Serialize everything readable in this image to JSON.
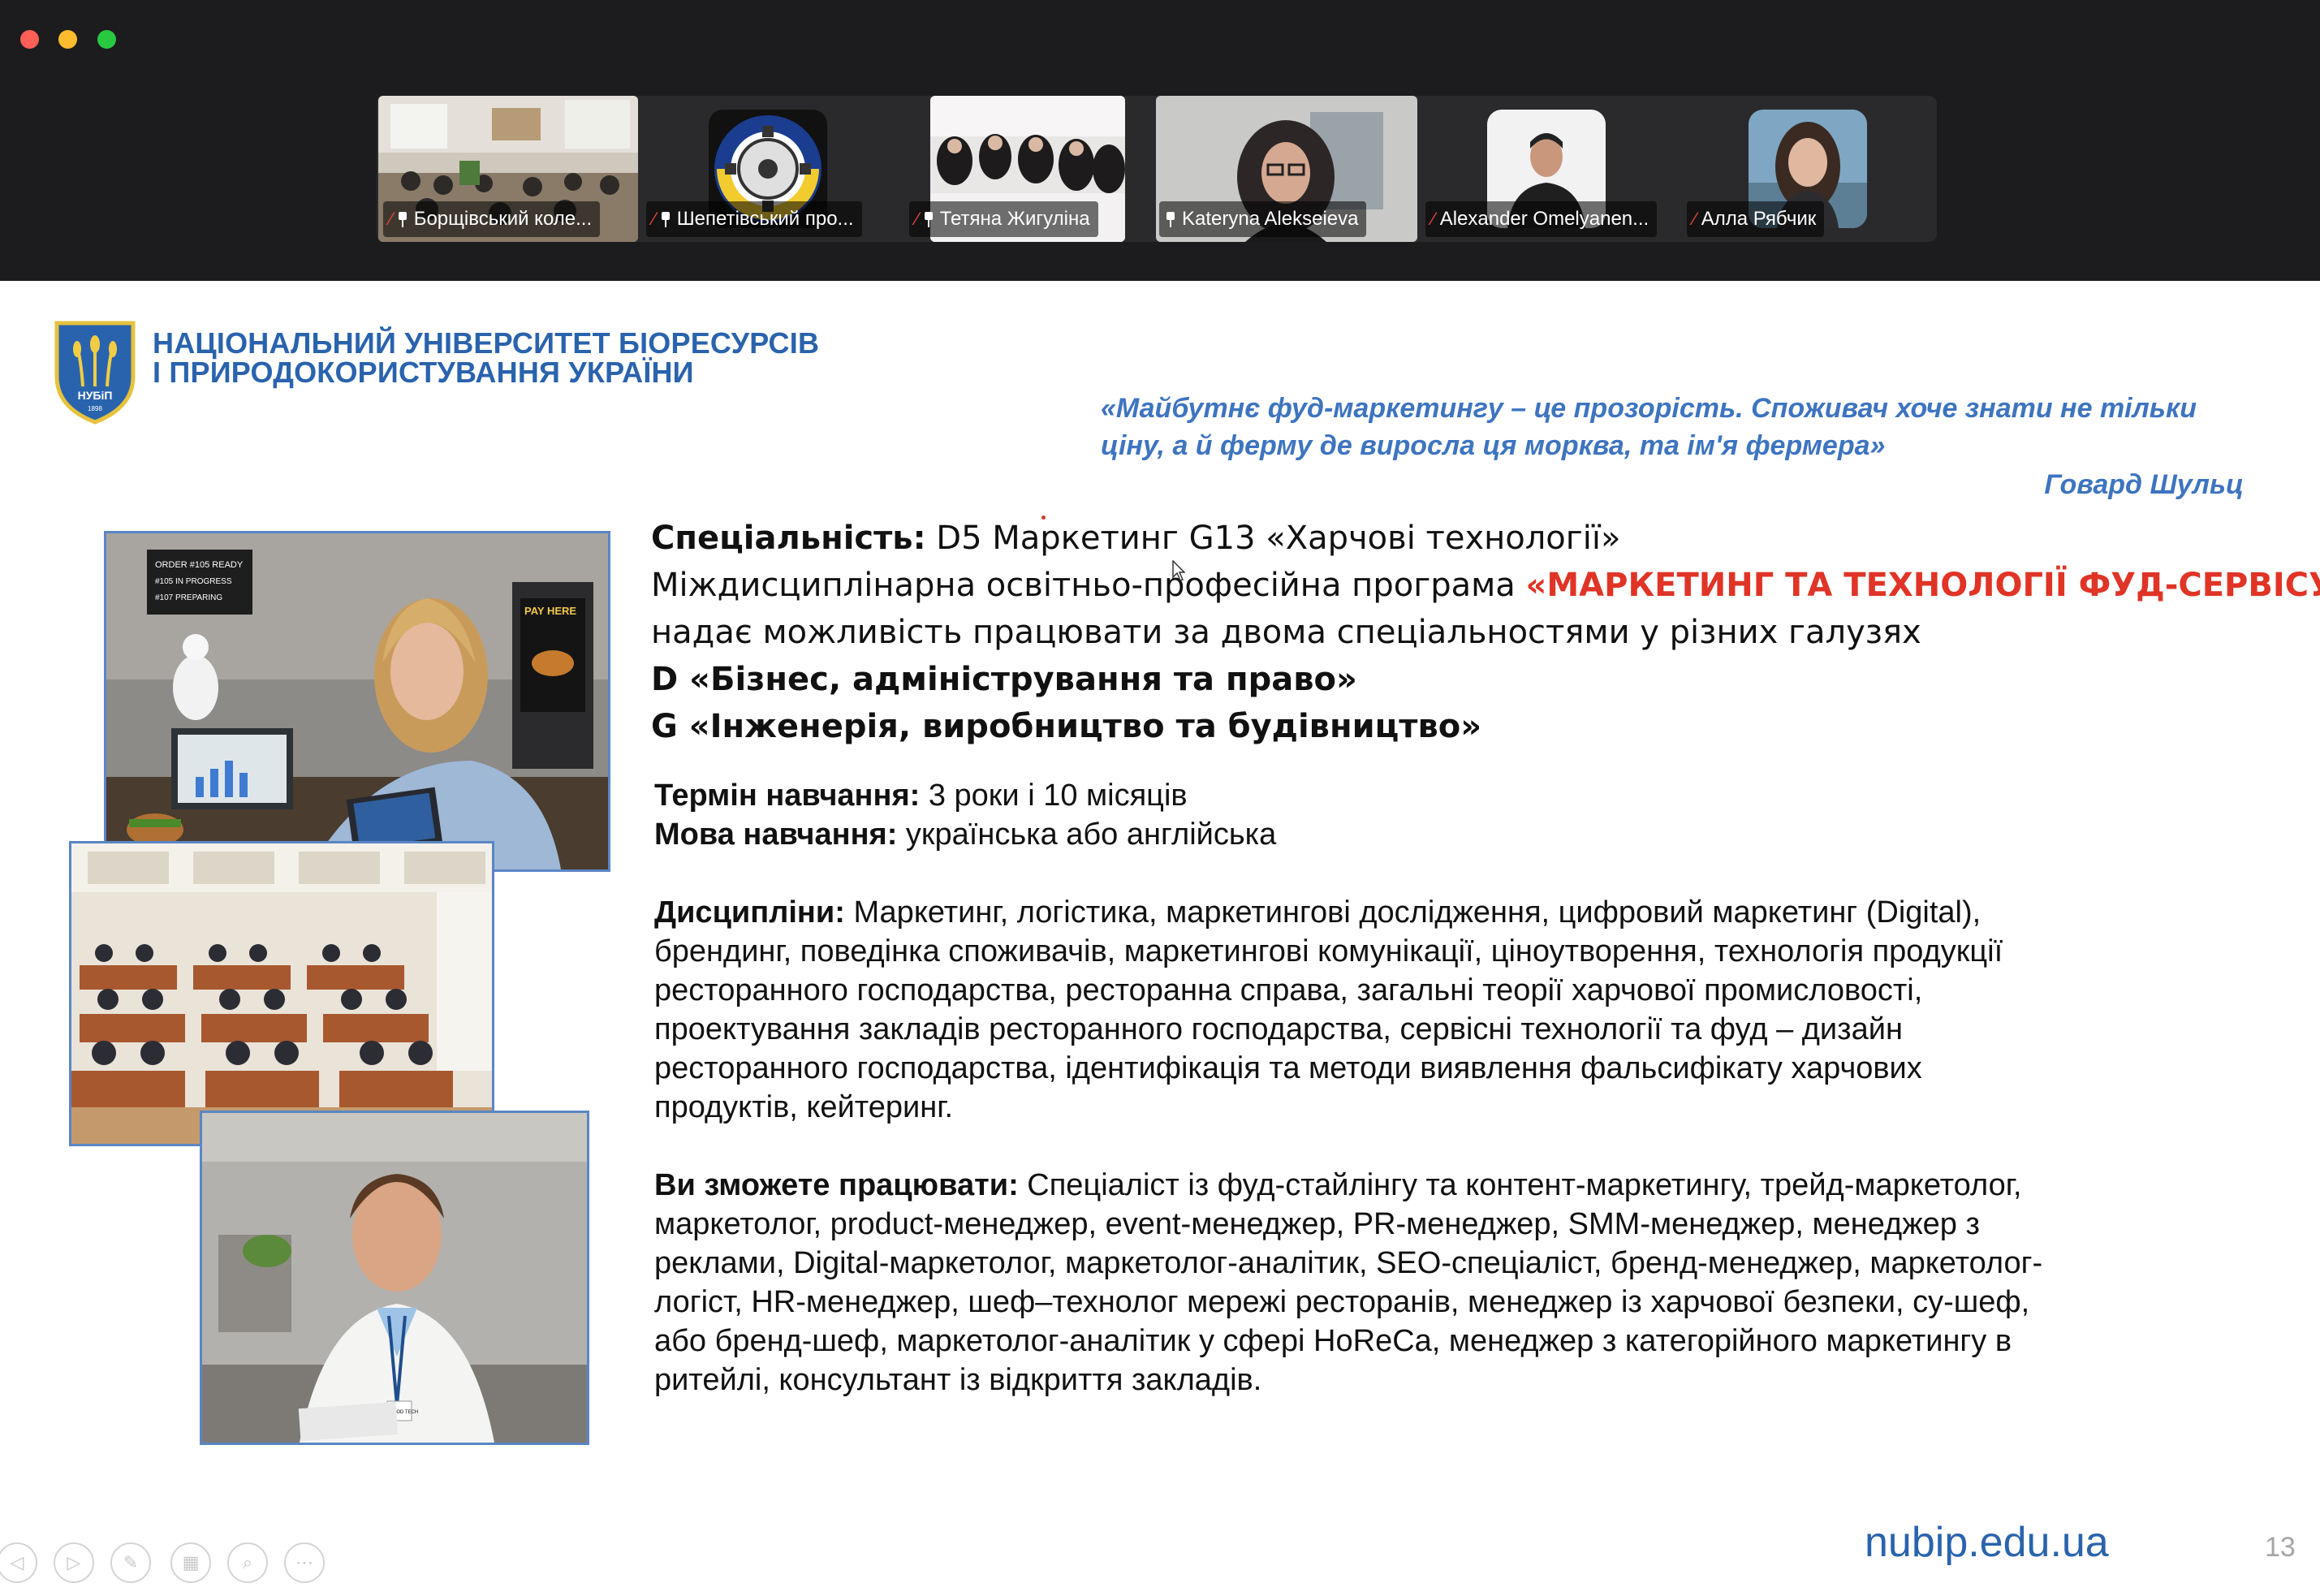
{
  "meeting": {
    "participants": [
      {
        "name": "Борщівський коле...",
        "muted": true,
        "pinned": true
      },
      {
        "name": "Шепетівський про...",
        "muted": true,
        "pinned": true
      },
      {
        "name": "Тетяна Жигуліна",
        "muted": true,
        "pinned": true
      },
      {
        "name": "Kateryna Alekseieva",
        "muted": false,
        "pinned": true,
        "active_speaker": true
      },
      {
        "name": "Alexander Omelyanen...",
        "muted": true,
        "pinned": false
      },
      {
        "name": "Алла Рябчик",
        "muted": true,
        "pinned": false
      }
    ]
  },
  "slide": {
    "university": {
      "line1": "НАЦІОНАЛЬНИЙ УНІВЕРСИТЕТ БІОРЕСУРСІВ",
      "line2": "І ПРИРОДОКОРИСТУВАННЯ УКРАЇНИ",
      "logo_text": "НУБіП",
      "logo_year": "1898"
    },
    "quote": {
      "line1": "«Майбутнє фуд-маркетингу – це прозорість. Споживач хоче знати не тільки",
      "line2": "ціну, а й ферму де виросла ця морква, та ім'я фермера»",
      "author": "Говард Шульц"
    },
    "specialty": {
      "label": "Спеціальність:",
      "value": " D5 Маркетинг G13 «Харчові технології»"
    },
    "program": {
      "prefix": "Міждисциплінарна освітньо-професійна програма ",
      "name": "«МАРКЕТИНГ ТА ТЕХНОЛОГІЇ ФУД-СЕРВІСУ»"
    },
    "provides": "надає можливість працювати за двома спеціальностями у різних галузях",
    "branch_d": "D «Бізнес, адміністрування та право»",
    "branch_g": "G «Інженерія, виробництво та будівництво»",
    "duration": {
      "label": "Термін навчання:",
      "value": " 3 роки і 10 місяців"
    },
    "language": {
      "label": "Мова навчання:",
      "value": " українська або англійська"
    },
    "disciplines": {
      "label": "Дисципліни:",
      "line1": " Маркетинг, логістика, маркетингові дослідження, цифровий маркетинг (Digital),",
      "line2": "брендинг, поведінка споживачів, маркетингові комунікації, ціноутворення, технологія продукції",
      "line3": "ресторанного господарства, ресторанна справа, загальні теорії харчової промисловості,",
      "line4": "проектування закладів ресторанного господарства, сервісні технології та фуд – дизайн",
      "line5": "ресторанного господарства, ідентифікація та методи виявлення фальсифікату харчових",
      "line6": "продуктів, кейтеринг."
    },
    "careers": {
      "label": "Ви зможете працювати:",
      "line1": " Спеціаліст із фуд-стайлінгу та контент-маркетингу, трейд-маркетолог,",
      "line2": "маркетолог, product-менеджер, event-менеджер, PR-менеджер, SMM-менеджер, менеджер з",
      "line3": "реклами, Digital-маркетолог, маркетолог-аналітик, SEO-спеціаліст, бренд-менеджер, маркетолог-",
      "line4": "логіст, HR-менеджер, шеф–технолог мережі ресторанів, менеджер із харчової безпеки, су-шеф,",
      "line5": "або бренд-шеф, маркетолог-аналітик у сфері HoReCa, менеджер з категорійного маркетингу в",
      "line6": "ритейлі, консультант із відкриття закладів."
    },
    "photo_text": {
      "order_board_1": "ORDER #105 READY",
      "order_board_2": "#105 IN PROGRESS",
      "order_board_3": "#107 PREPARING",
      "kiosk": "PAY HERE",
      "badge": "FOOD TECH"
    },
    "footer_url": "nubip.edu.ua",
    "page_number": "13"
  },
  "colors": {
    "title_blue": "#2a63ad",
    "quote_blue": "#3e74c0",
    "program_red": "#e03426",
    "active_speaker_border": "#3ec93e"
  }
}
